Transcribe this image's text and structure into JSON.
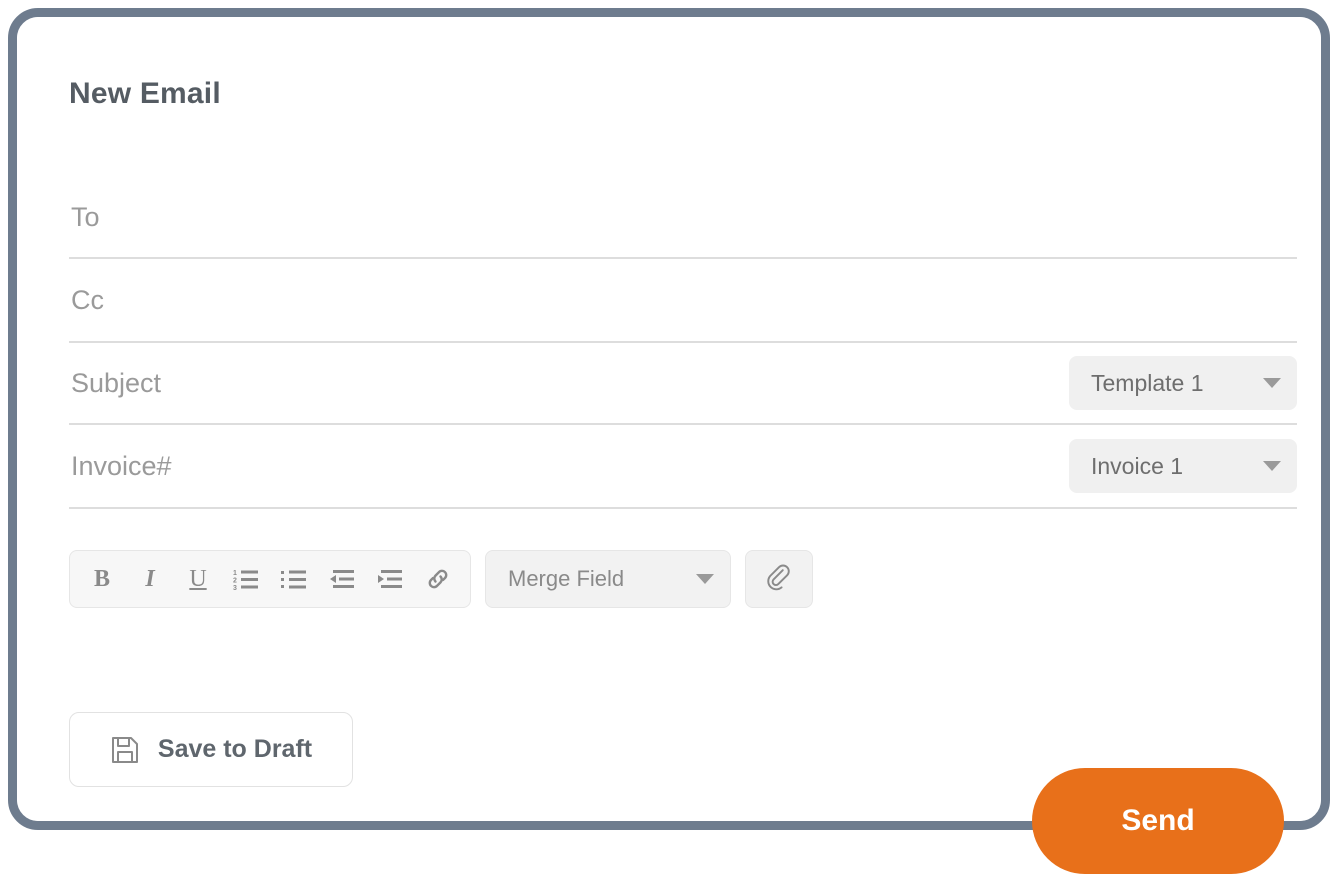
{
  "window": {
    "title": "New Email"
  },
  "colors": {
    "accent": "#e8701a",
    "card_border": "#6e7c8e",
    "label_gray": "#9a9a9a",
    "text_dark": "#555c63",
    "divider": "#dddddd",
    "control_bg": "#f0f0f0"
  },
  "form": {
    "rows": [
      {
        "name": "to",
        "label": "To",
        "value": "",
        "placeholder": "To"
      },
      {
        "name": "cc",
        "label": "Cc",
        "value": "",
        "placeholder": "Cc"
      },
      {
        "name": "subject",
        "label": "Subject",
        "value": "",
        "placeholder": "Subject"
      },
      {
        "name": "invoice",
        "label": "Invoice#",
        "value": "",
        "placeholder": "Invoice#"
      }
    ],
    "template_select": {
      "label": "Template 1",
      "icon": "chevron-down-icon",
      "options": [
        "Template 1"
      ]
    },
    "invoice_select": {
      "label": "Invoice 1",
      "icon": "chevron-down-icon",
      "options": [
        "Invoice 1"
      ]
    }
  },
  "toolbar": {
    "buttons": [
      {
        "name": "bold",
        "glyph": "B",
        "icon": "bold-icon"
      },
      {
        "name": "italic",
        "glyph": "I",
        "icon": "italic-icon"
      },
      {
        "name": "underline",
        "glyph": "U",
        "icon": "underline-icon"
      },
      {
        "name": "numbered-list",
        "glyph": "",
        "icon": "numbered-list-icon"
      },
      {
        "name": "bulleted-list",
        "glyph": "",
        "icon": "bulleted-list-icon"
      },
      {
        "name": "outdent",
        "glyph": "",
        "icon": "outdent-icon"
      },
      {
        "name": "indent",
        "glyph": "",
        "icon": "indent-icon"
      },
      {
        "name": "link",
        "glyph": "",
        "icon": "link-icon"
      }
    ],
    "merge_field": {
      "label": "Merge Field",
      "icon": "chevron-down-icon",
      "options": [
        "Merge Field"
      ]
    },
    "attach": {
      "icon": "paperclip-icon"
    }
  },
  "actions": {
    "save_draft": {
      "label": "Save to Draft",
      "icon": "floppy-disk-icon"
    },
    "send": {
      "label": "Send"
    }
  }
}
